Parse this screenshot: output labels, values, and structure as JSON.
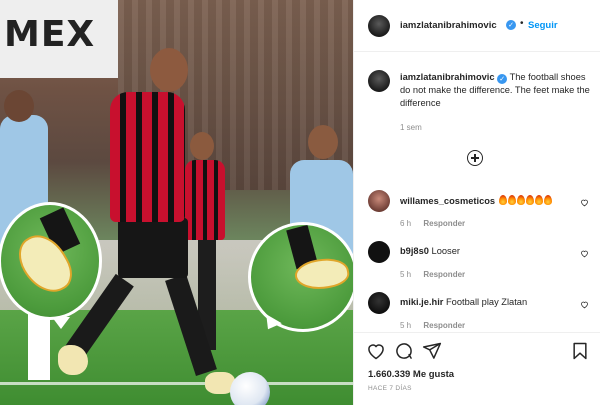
{
  "post_image": {
    "billboard_text": "MEX"
  },
  "header": {
    "username": "iamzlatanibrahimovic",
    "separator": "•",
    "follow_label": "Seguir"
  },
  "caption": {
    "username": "iamzlatanibrahimovic",
    "text": "The football shoes do not make the difference. The feet make the difference",
    "time": "1 sem"
  },
  "comments": [
    {
      "username": "willames_cosmeticos",
      "text": "🔥🔥🔥🔥🔥🔥",
      "time": "6 h",
      "reply_label": "Responder"
    },
    {
      "username": "b9j8s0",
      "text": "Looser",
      "time": "5 h",
      "reply_label": "Responder"
    },
    {
      "username": "miki.je.hir",
      "text": "Football play Zlatan",
      "time": "5 h",
      "reply_label": "Responder"
    }
  ],
  "footer": {
    "likes": "1.660.339 Me gusta",
    "posted": "HACE 7 DÍAS"
  },
  "icons": {
    "verified": "verified-badge-icon",
    "load_more": "plus-circle-icon",
    "like": "heart-icon",
    "comment": "comment-bubble-icon",
    "share": "paper-plane-icon",
    "save": "bookmark-icon"
  },
  "colors": {
    "accent": "#0095f6",
    "verified": "#3897f0",
    "text": "#262626",
    "muted": "#8e8e8e"
  }
}
